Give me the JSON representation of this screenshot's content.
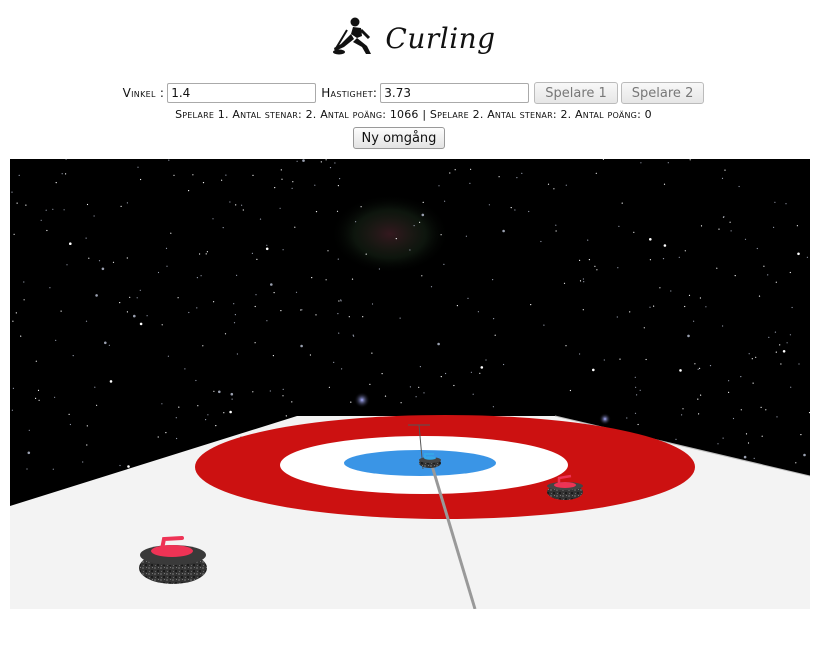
{
  "header": {
    "title": "Curling",
    "icon": "curler-icon"
  },
  "controls": {
    "angle_label": "Vinkel :",
    "angle_value": "1.4",
    "speed_label": "Hastighet:",
    "speed_value": "3.73",
    "player1_button": "Spelare 1",
    "player2_button": "Spelare 2"
  },
  "status": {
    "text": "Spelare 1. Antal stenar: 2. Antal poäng: 1066 | Spelare 2. Antal stenar: 2. Antal poäng: 0"
  },
  "new_round_button": "Ny omgång",
  "scene": {
    "sky_color": "#000000",
    "ice_color": "#f3f3f3",
    "house_colors": {
      "outer": "#cc1111",
      "middle": "#ffffff",
      "inner": "#3a95e6"
    },
    "stones": [
      {
        "team": "red",
        "handle_color": "#ee3355",
        "position": "foreground-left"
      },
      {
        "team": "red",
        "handle_color": "#ee3355",
        "position": "right-of-house"
      },
      {
        "team": "blue",
        "handle_color": "#36a6e8",
        "position": "button"
      }
    ]
  }
}
